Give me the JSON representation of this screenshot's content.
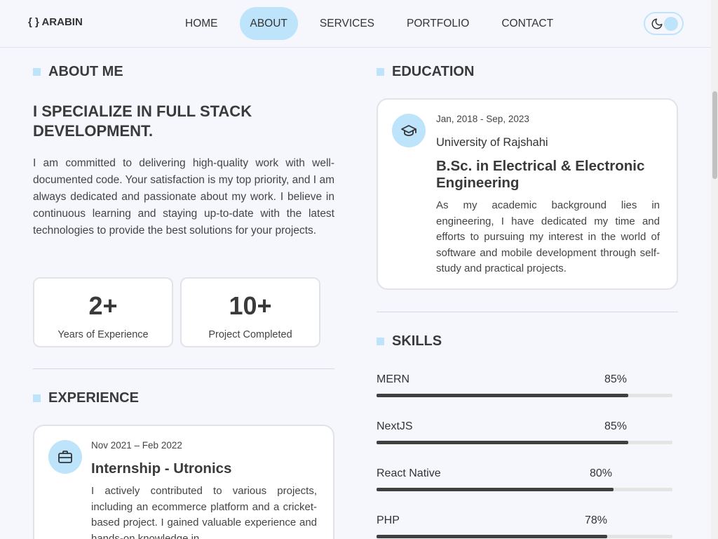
{
  "nav": {
    "logo": "{ } ARABIN",
    "items": [
      {
        "label": "HOME",
        "active": false
      },
      {
        "label": "ABOUT",
        "active": true
      },
      {
        "label": "SERVICES",
        "active": false
      },
      {
        "label": "PORTFOLIO",
        "active": false
      },
      {
        "label": "CONTACT",
        "active": false
      }
    ],
    "theme_toggle_icon": "moon-icon"
  },
  "about": {
    "title": "ABOUT ME",
    "headline": "I SPECIALIZE IN FULL STACK DEVELOPMENT.",
    "paragraph": "I am committed to delivering high-quality work with well-documented code. Your satisfaction is my top priority, and I am always dedicated and passionate about my work. I believe in continuous learning and staying up-to-date with the latest technologies to provide the best solutions for your projects.",
    "stats": [
      {
        "value": "2+",
        "label": "Years of Experience"
      },
      {
        "value": "10+",
        "label": "Project Completed"
      }
    ]
  },
  "experience": {
    "title": "EXPERIENCE",
    "items": [
      {
        "date": "Nov 2021 – Feb 2022",
        "role": "Internship - Utronics",
        "description": "I actively contributed to various projects, including an ecommerce platform and a cricket-based project. I gained valuable experience and hands-on knowledge in",
        "icon": "briefcase-icon"
      }
    ]
  },
  "education": {
    "title": "EDUCATION",
    "items": [
      {
        "date": "Jan, 2018 - Sep, 2023",
        "institution": "University of Rajshahi",
        "degree": "B.Sc. in Electrical & Electronic Engineering",
        "description": "As my academic background lies in engineering, I have dedicated my time and efforts to pursuing my interest in the world of software and mobile development through self-study and practical projects.",
        "icon": "graduation-cap-icon"
      }
    ]
  },
  "skills": {
    "title": "SKILLS",
    "items": [
      {
        "name": "MERN",
        "percent": "85%",
        "level": 0.85
      },
      {
        "name": "NextJS",
        "percent": "85%",
        "level": 0.85
      },
      {
        "name": "React Native",
        "percent": "80%",
        "level": 0.8
      },
      {
        "name": "PHP",
        "percent": "78%",
        "level": 0.78
      }
    ]
  },
  "colors": {
    "accent": "#bde4fa",
    "background": "#f5f7fd",
    "text": "#3a3a3a",
    "bar_fill": "#3f3f3f",
    "bar_track": "#e4e4e4"
  }
}
